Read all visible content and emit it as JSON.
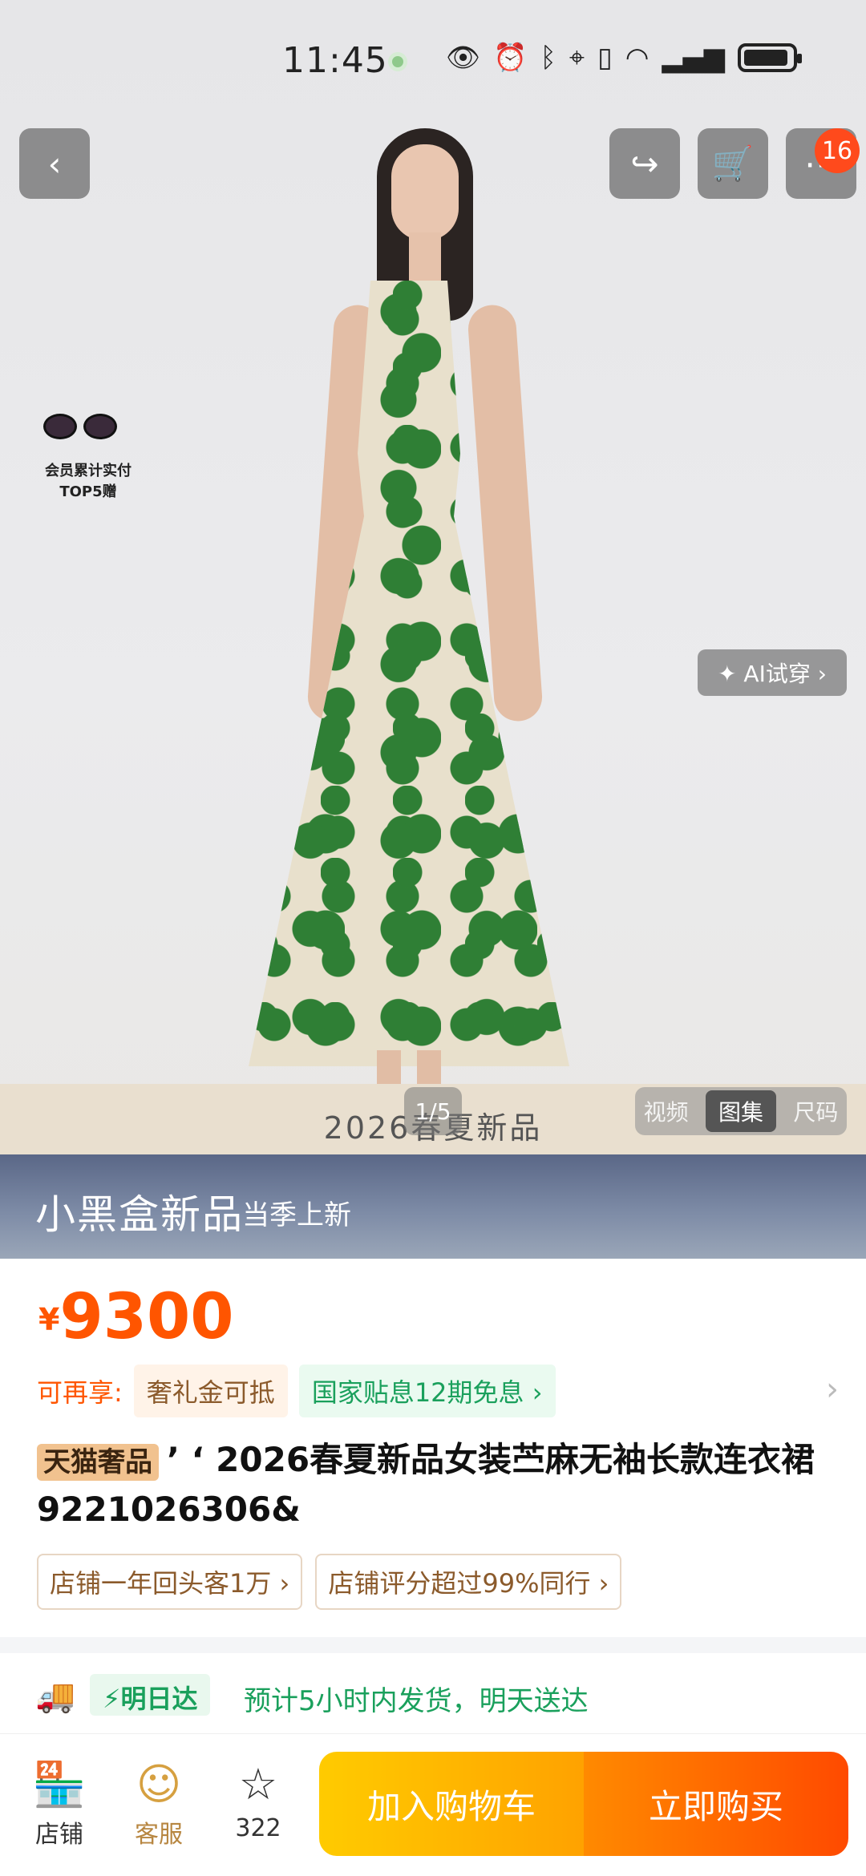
{
  "status_bar": {
    "time": "11:45",
    "icons": [
      "eye-icon",
      "alarm-icon",
      "bluetooth-icon",
      "location-icon",
      "vibrate-icon",
      "wifi-icon",
      "5g-signal-icon",
      "battery-icon"
    ]
  },
  "header": {
    "cart_badge": "16"
  },
  "hero": {
    "promo_text_line1": "会员累计实付",
    "promo_text_line2": "TOP5赠",
    "ai_try_label": "✦ AI试穿 ›",
    "page_indicator": "1/5",
    "season_text": "2026春夏新品",
    "media_tabs": [
      "视频",
      "图集",
      "尺码"
    ],
    "active_media_tab": 1
  },
  "banner": {
    "title": "小黑盒新品",
    "subtitle": "当季上新"
  },
  "product": {
    "currency": "¥",
    "price": "9300",
    "enjoy_label": "可再享:",
    "tag_gift": "奢礼金可抵",
    "tag_gov": "国家贴息12期免息 ›",
    "tmall_tag": "天猫奢品",
    "title_text": "’       ‘  2026春夏新品女装苎麻无袖长款连衣裙9221026306&",
    "shop_tags": [
      "店铺一年回头客1万 ›",
      "店铺评分超过99%同行 ›"
    ]
  },
  "delivery": {
    "badge": "⚡明日达",
    "text": "预计5小时内发货，明天送达"
  },
  "bottom_bar": {
    "shop_label": "店铺",
    "service_label": "客服",
    "favorites_count": "322",
    "add_to_cart": "加入购物车",
    "buy_now": "立即购买"
  },
  "colors": {
    "accent": "#ff5500",
    "green": "#1aa05c",
    "cart_yellow": "#ffb800",
    "buy_orange": "#ff5a00"
  }
}
